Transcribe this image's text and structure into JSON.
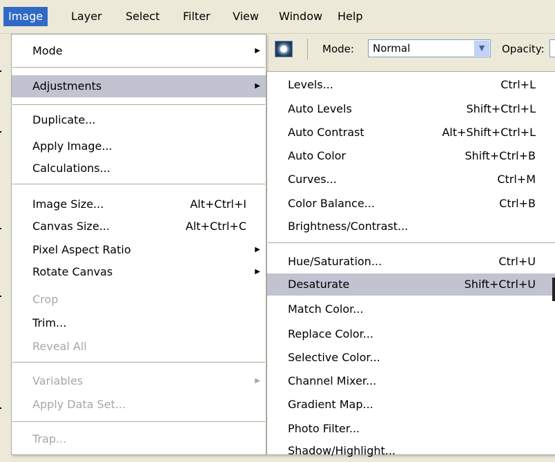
{
  "menubar": {
    "items": [
      {
        "label": "Image"
      },
      {
        "label": "Layer"
      },
      {
        "label": "Select"
      },
      {
        "label": "Filter"
      },
      {
        "label": "View"
      },
      {
        "label": "Window"
      },
      {
        "label": "Help"
      }
    ]
  },
  "options_bar": {
    "tool_icon": "brush-preset-icon",
    "mode_label": "Mode:",
    "mode_value": "Normal",
    "opacity_label": "Opacity:"
  },
  "image_menu": {
    "items": [
      {
        "label": "Mode",
        "submenu": true
      },
      {
        "label": "Adjustments",
        "submenu": true,
        "highlighted": true
      },
      {
        "label": "Duplicate..."
      },
      {
        "label": "Apply Image..."
      },
      {
        "label": "Calculations..."
      },
      {
        "label": "Image Size...",
        "shortcut": "Alt+Ctrl+I"
      },
      {
        "label": "Canvas Size...",
        "shortcut": "Alt+Ctrl+C"
      },
      {
        "label": "Pixel Aspect Ratio",
        "submenu": true
      },
      {
        "label": "Rotate Canvas",
        "submenu": true
      },
      {
        "label": "Crop",
        "disabled": true
      },
      {
        "label": "Trim..."
      },
      {
        "label": "Reveal All",
        "disabled": true
      },
      {
        "label": "Variables",
        "submenu": true,
        "disabled": true
      },
      {
        "label": "Apply Data Set...",
        "disabled": true
      },
      {
        "label": "Trap...",
        "disabled": true
      }
    ]
  },
  "adjustments_menu": {
    "items": [
      {
        "label": "Levels...",
        "shortcut": "Ctrl+L"
      },
      {
        "label": "Auto Levels",
        "shortcut": "Shift+Ctrl+L"
      },
      {
        "label": "Auto Contrast",
        "shortcut": "Alt+Shift+Ctrl+L"
      },
      {
        "label": "Auto Color",
        "shortcut": "Shift+Ctrl+B"
      },
      {
        "label": "Curves...",
        "shortcut": "Ctrl+M"
      },
      {
        "label": "Color Balance...",
        "shortcut": "Ctrl+B"
      },
      {
        "label": "Brightness/Contrast..."
      },
      {
        "label": "Hue/Saturation...",
        "shortcut": "Ctrl+U"
      },
      {
        "label": "Desaturate",
        "shortcut": "Shift+Ctrl+U",
        "highlighted": true
      },
      {
        "label": "Match Color..."
      },
      {
        "label": "Replace Color..."
      },
      {
        "label": "Selective Color..."
      },
      {
        "label": "Channel Mixer..."
      },
      {
        "label": "Gradient Map..."
      },
      {
        "label": "Photo Filter..."
      },
      {
        "label": "Shadow/Highlight..."
      }
    ]
  },
  "colors": {
    "menubar_bg": "#ece9d8",
    "menubar_active": "#316ac5",
    "menu_bg": "#ffffff",
    "menu_highlight": "#c1c3d1",
    "disabled_text": "#a7a6aa",
    "separator": "#aca899"
  }
}
